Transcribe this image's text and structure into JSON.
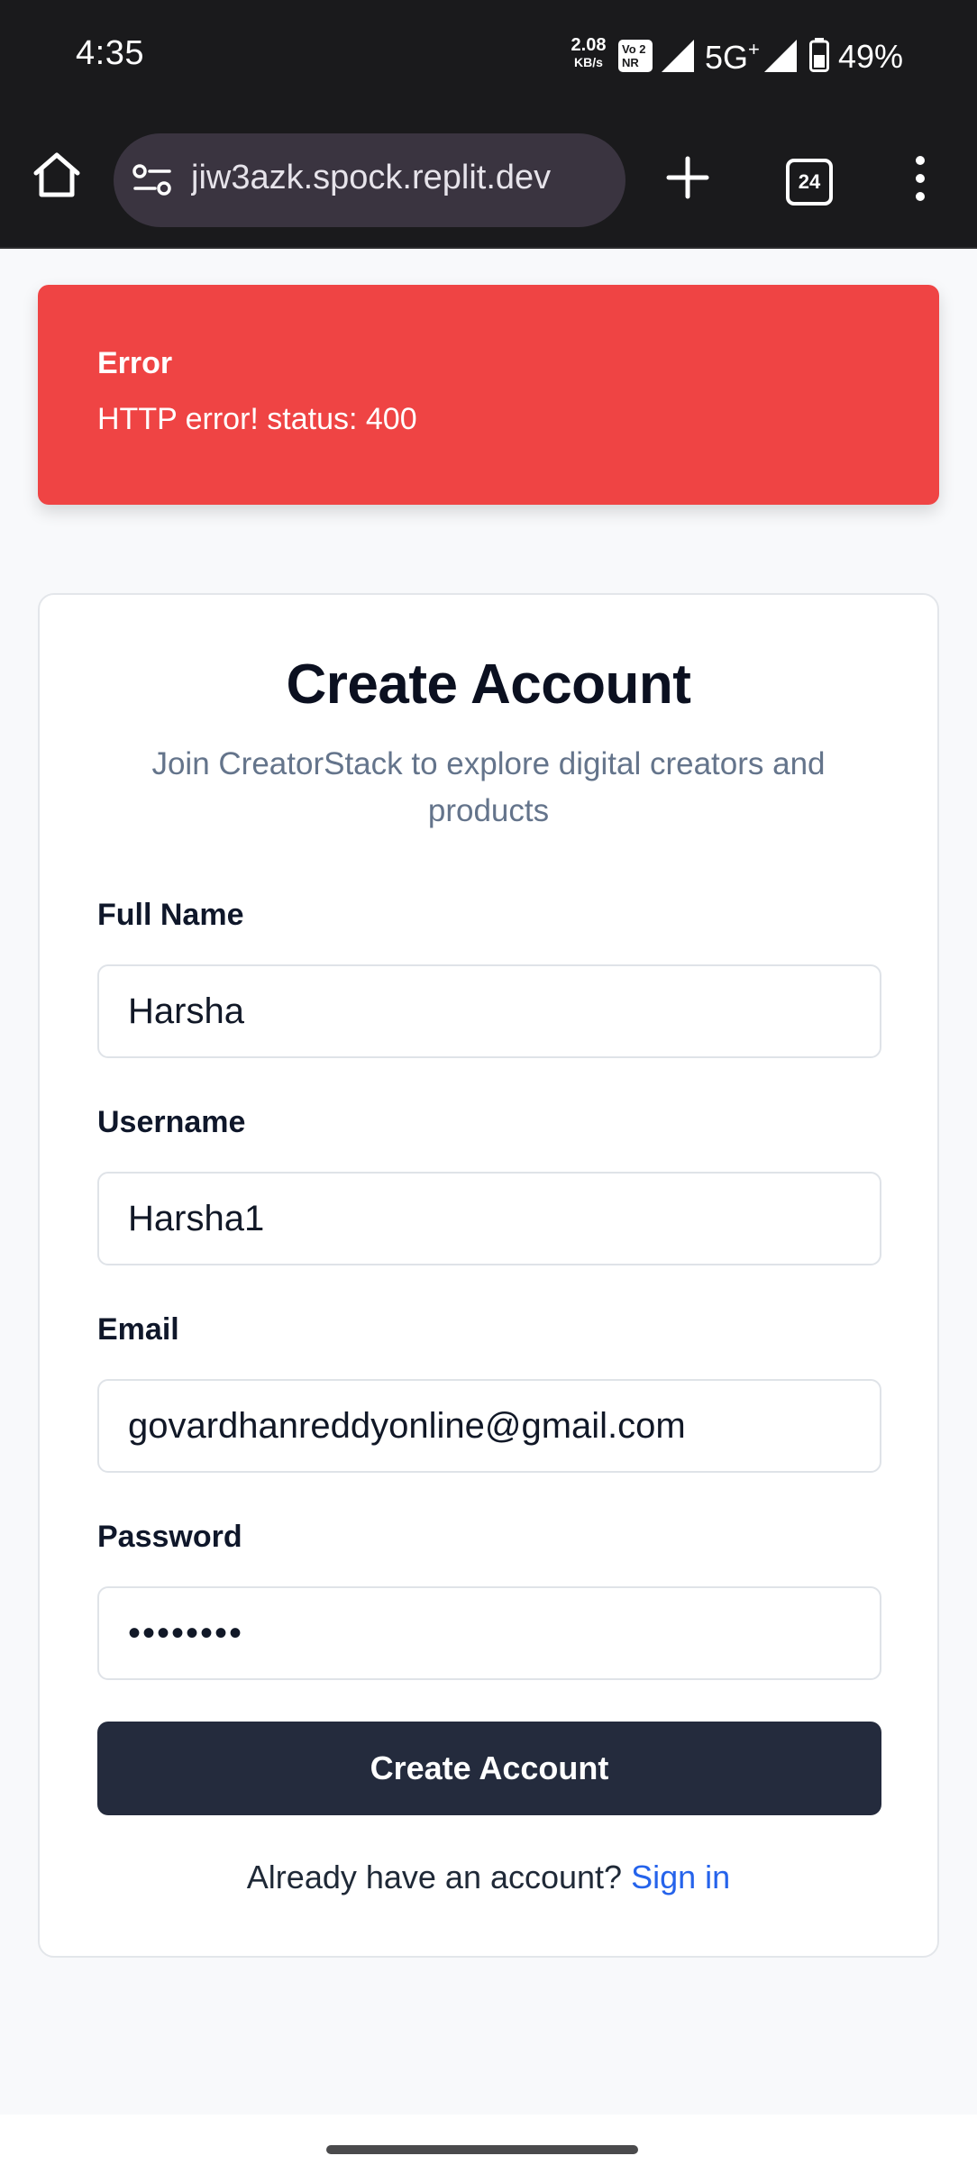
{
  "status_bar": {
    "time": "4:35",
    "net_speed_value": "2.08",
    "net_speed_unit": "KB/s",
    "volte_top": "Vo 2",
    "volte_bottom": "NR",
    "network_type": "5G",
    "network_plus": "+",
    "battery_percent": "49%"
  },
  "browser": {
    "url": "jiw3azk.spock.replit.dev",
    "tab_count": "24"
  },
  "error_alert": {
    "title": "Error",
    "message": "HTTP error! status: 400",
    "background_color": "#ef4444"
  },
  "form": {
    "title": "Create Account",
    "subtitle": "Join CreatorStack to explore digital creators and products",
    "fields": {
      "full_name": {
        "label": "Full Name",
        "value": "Harsha"
      },
      "username": {
        "label": "Username",
        "value": "Harsha1"
      },
      "email": {
        "label": "Email",
        "value": "govardhanreddyonline@gmail.com"
      },
      "password": {
        "label": "Password",
        "value": "••••••••"
      }
    },
    "submit_label": "Create Account",
    "signin_prompt": "Already have an account?",
    "signin_link": "Sign in"
  },
  "colors": {
    "primary_button": "#242b3d",
    "link": "#2563eb",
    "error": "#ef4444"
  }
}
